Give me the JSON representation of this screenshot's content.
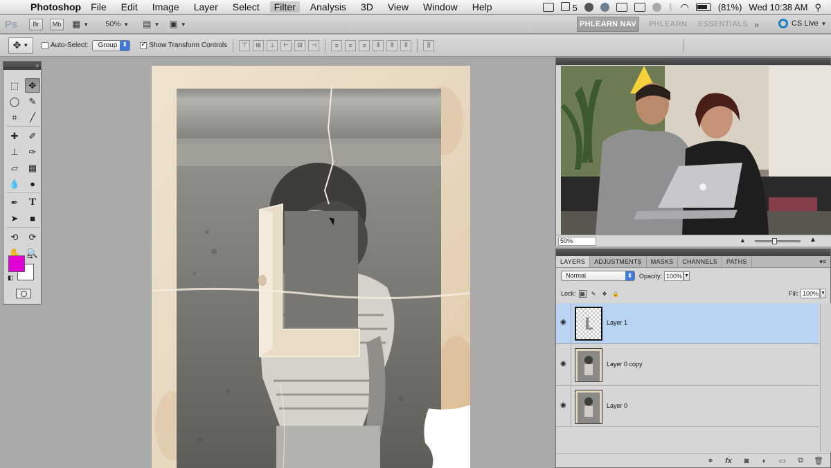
{
  "menubar": {
    "app_name": "Photoshop",
    "menus": [
      "File",
      "Edit",
      "Image",
      "Layer",
      "Select",
      "Filter",
      "Analysis",
      "3D",
      "View",
      "Window",
      "Help"
    ],
    "highlighted_menu": "Filter",
    "status": {
      "adobe_count": "5",
      "battery": "(81%)",
      "clock": "Wed 10:38 AM"
    }
  },
  "appbar": {
    "logo": "Ps",
    "bridge": "Br",
    "mini_bridge": "Mb",
    "zoom": "50%",
    "workspaces": [
      "PHLEARN NAV",
      "PHLEARN",
      "ESSENTIALS"
    ],
    "more": "»",
    "cs_live": "CS Live"
  },
  "options": {
    "auto_select_label": "Auto-Select:",
    "auto_select_checked": false,
    "auto_select_target": "Group",
    "transform_label": "Show Transform Controls",
    "transform_checked": true
  },
  "tools": {
    "foreground_color": "#e300d6",
    "background_color": "#ffffff",
    "icons": [
      "marquee-icon",
      "move-icon",
      "lasso-icon",
      "quick-select-icon",
      "crop-icon",
      "eyedropper-icon",
      "healing-icon",
      "brush-icon",
      "stamp-icon",
      "history-brush-icon",
      "eraser-icon",
      "gradient-icon",
      "blur-icon",
      "dodge-icon",
      "pen-icon",
      "type-icon",
      "path-select-icon",
      "shape-icon",
      "3d-rotate-icon",
      "3d-orbit-icon",
      "hand-icon",
      "zoom-icon"
    ]
  },
  "navigator": {
    "zoom_field": "50%"
  },
  "layers_panel": {
    "tabs": [
      "LAYERS",
      "ADJUSTMENTS",
      "MASKS",
      "CHANNELS",
      "PATHS"
    ],
    "active_tab": "LAYERS",
    "blend_mode": "Normal",
    "opacity_label": "Opacity:",
    "opacity": "100%",
    "lock_label": "Lock:",
    "fill_label": "Fill:",
    "fill": "100%",
    "layers": [
      {
        "name": "Layer 1",
        "selected": true,
        "visible": true
      },
      {
        "name": "Layer 0 copy",
        "selected": false,
        "visible": true
      },
      {
        "name": "Layer 0",
        "selected": false,
        "visible": true
      }
    ],
    "footer_icons": [
      "link-layers-icon",
      "fx-icon",
      "add-mask-icon",
      "adjustment-layer-icon",
      "new-group-icon",
      "new-layer-icon",
      "trash-icon"
    ]
  }
}
